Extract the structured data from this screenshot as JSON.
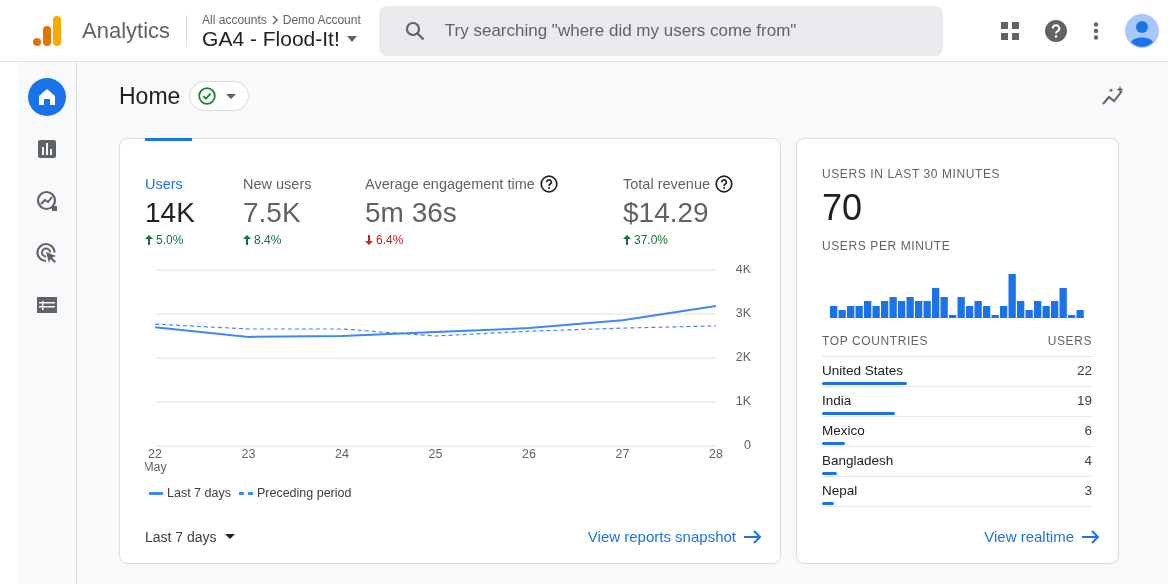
{
  "header": {
    "product": "Analytics",
    "breadcrumb": [
      "All accounts",
      "Demo Account"
    ],
    "property": "GA4 - Flood-It!",
    "search": {
      "placeholder": "Try searching \"where did my users come from\""
    }
  },
  "sidebar": {
    "items": [
      {
        "kind": "home",
        "selected": true
      },
      {
        "kind": "reports",
        "selected": false
      },
      {
        "kind": "explore",
        "selected": false
      },
      {
        "kind": "advertising",
        "selected": false
      },
      {
        "kind": "configure",
        "selected": false
      }
    ]
  },
  "page": {
    "title": "Home"
  },
  "overview": {
    "metrics": [
      {
        "label": "Users",
        "value": "14K",
        "change": "5.0%",
        "increase": true,
        "selected": true,
        "help": false
      },
      {
        "label": "New users",
        "value": "7.5K",
        "change": "8.4%",
        "increase": true,
        "selected": false,
        "help": false
      },
      {
        "label": "Average engagement time",
        "value": "5m 36s",
        "change": "6.4%",
        "increase": false,
        "selected": false,
        "help": true
      },
      {
        "label": "Total revenue",
        "value": "$14.29",
        "change": "37.0%",
        "increase": true,
        "selected": false,
        "help": true
      }
    ],
    "chart_data": {
      "type": "line",
      "grid": true,
      "categories": [
        "22 May",
        "23",
        "24",
        "25",
        "26",
        "27",
        "28"
      ],
      "ylim": [
        0,
        4000
      ],
      "yticks": [
        {
          "value": 0,
          "label": "0"
        },
        {
          "value": 1000,
          "label": "1K"
        },
        {
          "value": 2000,
          "label": "2K"
        },
        {
          "value": 3000,
          "label": "3K"
        },
        {
          "value": 4000,
          "label": "4K"
        }
      ],
      "series": [
        {
          "name": "Last 7 days",
          "color": "#4285f4",
          "line_style": "solid",
          "values": [
            2700,
            2480,
            2500,
            2590,
            2680,
            2860,
            3180
          ]
        },
        {
          "name": "Preceding period",
          "color": "#4285f4",
          "line_style": "dashed",
          "values": [
            2770,
            2660,
            2660,
            2500,
            2610,
            2680,
            2730
          ]
        }
      ]
    },
    "date_range": "Last 7 days",
    "link": "View reports snapshot"
  },
  "realtime": {
    "title": "USERS IN LAST 30 MINUTES",
    "value": "70",
    "subtitle": "USERS PER MINUTE",
    "columns": [
      "TOP COUNTRIES",
      "USERS"
    ],
    "rows": [
      {
        "country": "United States",
        "users": "22",
        "level": 0.314
      },
      {
        "country": "India",
        "users": "19",
        "level": 0.271
      },
      {
        "country": "Mexico",
        "users": "6",
        "level": 0.086
      },
      {
        "country": "Bangladesh",
        "users": "4",
        "level": 0.057
      },
      {
        "country": "Nepal",
        "users": "3",
        "level": 0.043
      }
    ],
    "link": "View realtime"
  }
}
